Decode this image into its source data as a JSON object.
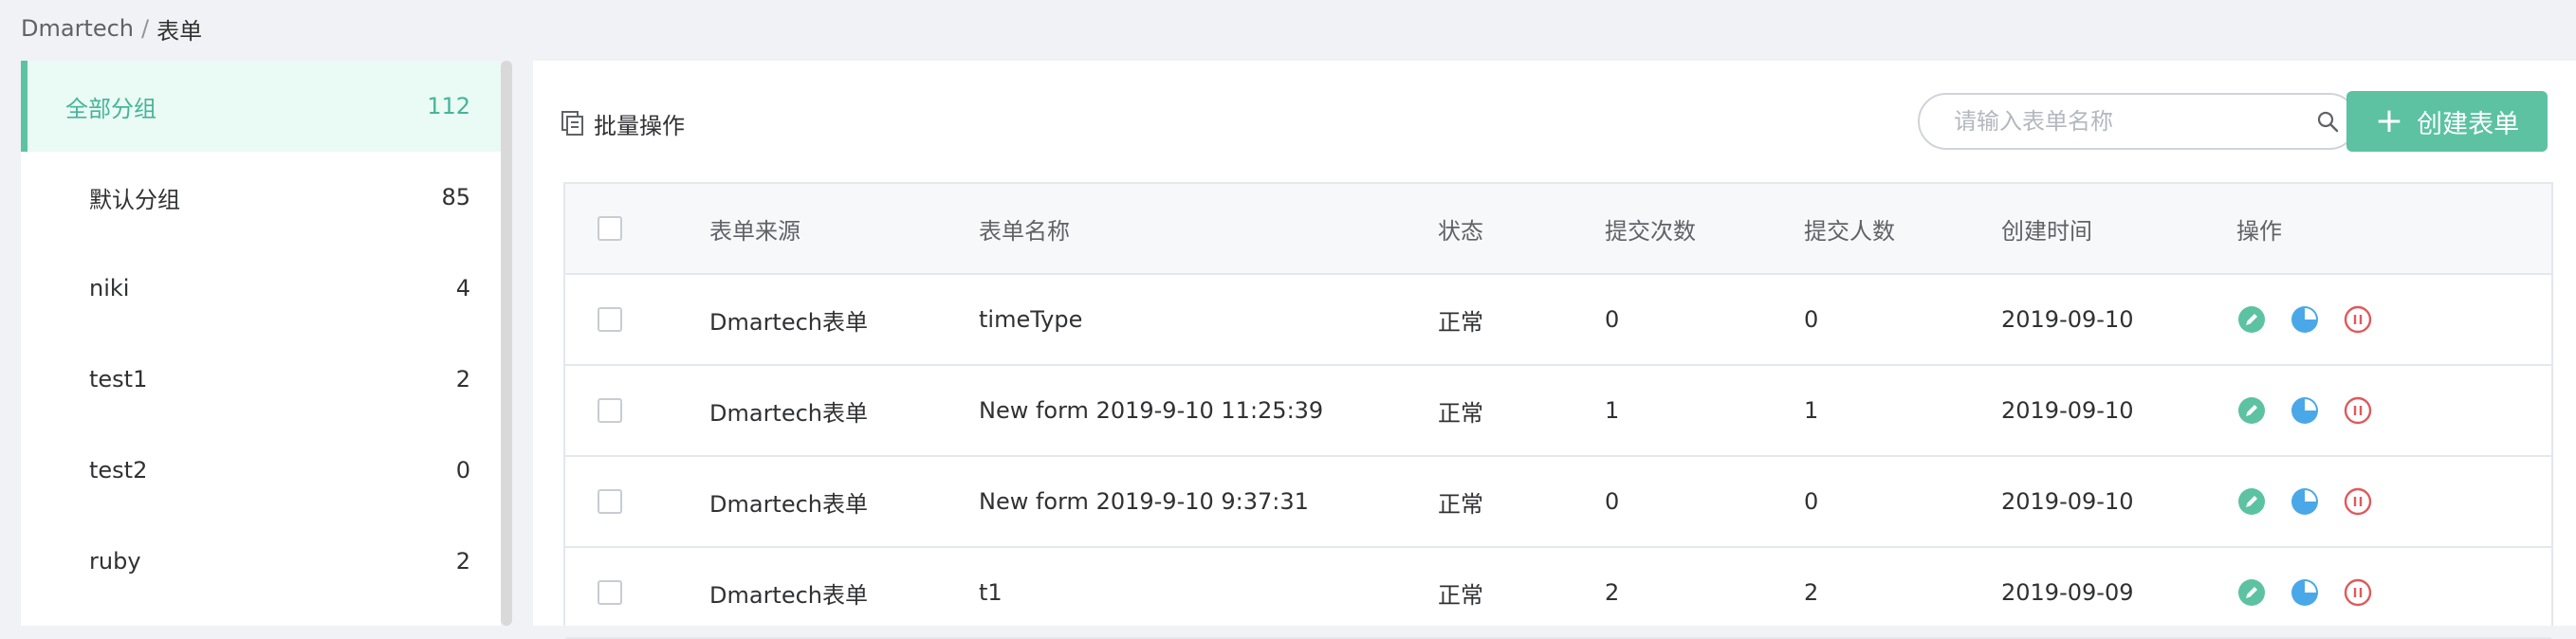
{
  "breadcrumb": {
    "root": "Dmartech",
    "separator": "/",
    "current": "表单"
  },
  "sidebar": {
    "items": [
      {
        "label": "全部分组",
        "count": "112",
        "active": true
      },
      {
        "label": "默认分组",
        "count": "85"
      },
      {
        "label": "niki",
        "count": "4"
      },
      {
        "label": "test1",
        "count": "2"
      },
      {
        "label": "test2",
        "count": "0"
      },
      {
        "label": "ruby",
        "count": "2"
      }
    ]
  },
  "toolbar": {
    "batch_label": "批量操作",
    "batch_icon": "copy-icon",
    "search_placeholder": "请输入表单名称",
    "search_value": "",
    "create_label": "创建表单"
  },
  "table": {
    "headers": {
      "source": "表单来源",
      "name": "表单名称",
      "status": "状态",
      "submissions": "提交次数",
      "submitters": "提交人数",
      "created": "创建时间",
      "actions": "操作"
    },
    "rows": [
      {
        "source": "Dmartech表单",
        "name": "timeType",
        "status": "正常",
        "submissions": "0",
        "submitters": "0",
        "created": "2019-09-10"
      },
      {
        "source": "Dmartech表单",
        "name": "New form 2019-9-10 11:25:39",
        "status": "正常",
        "submissions": "1",
        "submitters": "1",
        "created": "2019-09-10"
      },
      {
        "source": "Dmartech表单",
        "name": "New form 2019-9-10 9:37:31",
        "status": "正常",
        "submissions": "0",
        "submitters": "0",
        "created": "2019-09-10"
      },
      {
        "source": "Dmartech表单",
        "name": "t1",
        "status": "正常",
        "submissions": "2",
        "submitters": "2",
        "created": "2019-09-09"
      }
    ],
    "action_icons": [
      "edit-icon",
      "chart-pie-icon",
      "pause-icon"
    ]
  },
  "colors": {
    "accent": "#5cc2a2",
    "chart_blue": "#4aa8e8",
    "pause_red": "#e0595b"
  }
}
